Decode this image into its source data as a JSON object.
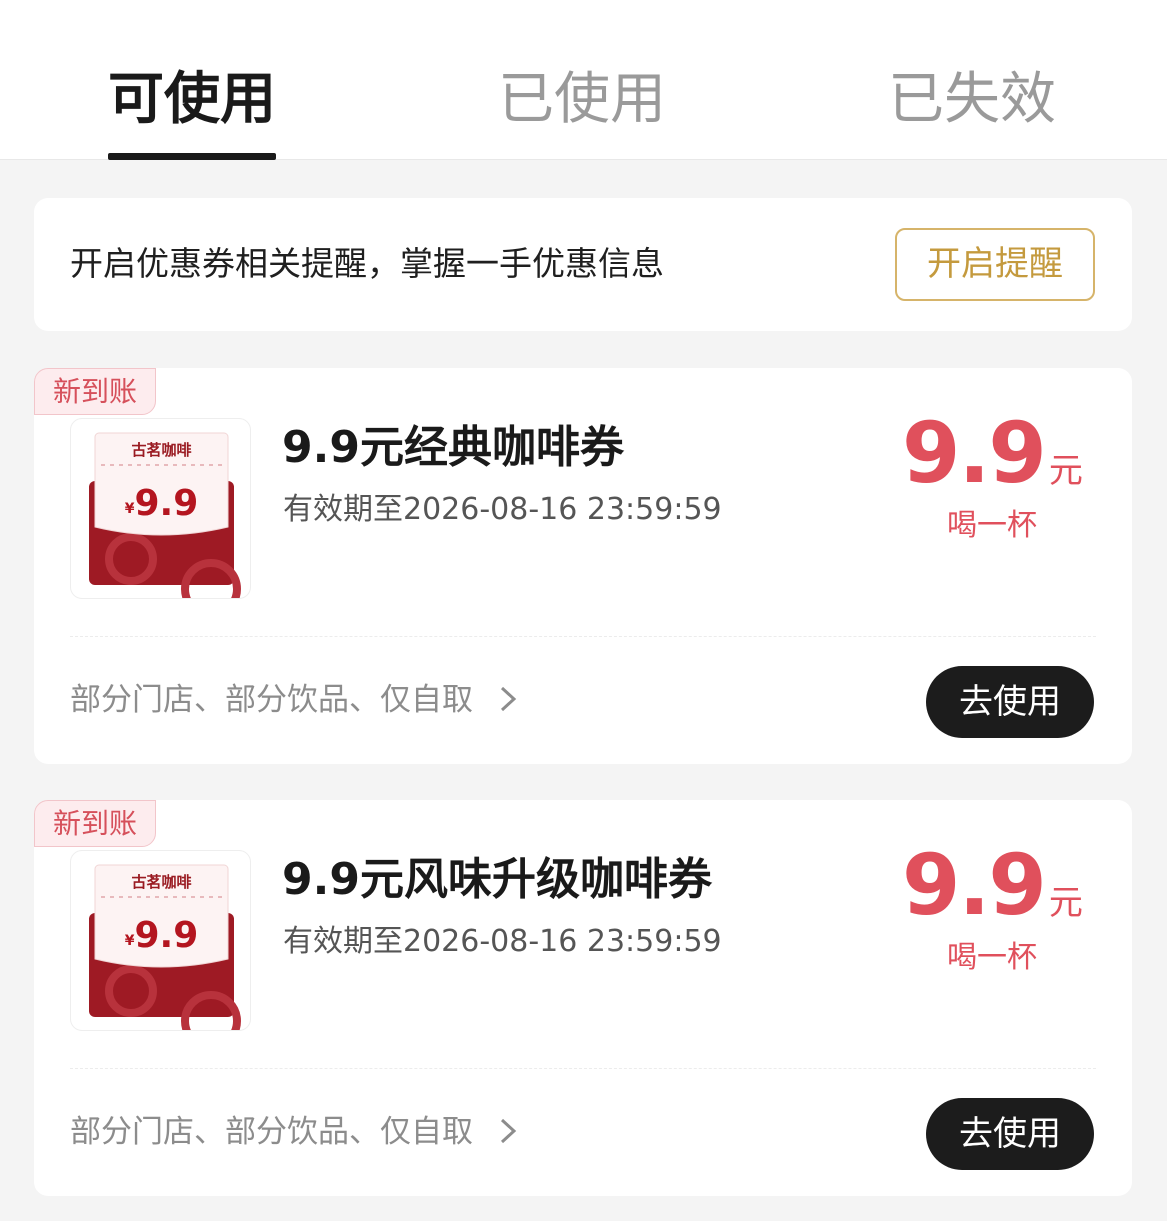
{
  "tabs": [
    {
      "label": "可使用",
      "active": true
    },
    {
      "label": "已使用",
      "active": false
    },
    {
      "label": "已失效",
      "active": false
    }
  ],
  "reminder": {
    "text": "开启优惠券相关提醒，掌握一手优惠信息",
    "button_label": "开启提醒"
  },
  "coupons": [
    {
      "badge": "新到账",
      "thumb_brand": "古茗咖啡",
      "thumb_currency": "¥",
      "thumb_price": "9.9",
      "title": "9.9元经典咖啡券",
      "expiry": "有效期至2026-08-16 23:59:59",
      "value": "9.9",
      "unit": "元",
      "value_note": "喝一杯",
      "terms": "部分门店、部分饮品、仅自取",
      "use_label": "去使用"
    },
    {
      "badge": "新到账",
      "thumb_brand": "古茗咖啡",
      "thumb_currency": "¥",
      "thumb_price": "9.9",
      "title": "9.9元风味升级咖啡券",
      "expiry": "有效期至2026-08-16 23:59:59",
      "value": "9.9",
      "unit": "元",
      "value_note": "喝一杯",
      "terms": "部分门店、部分饮品、仅自取",
      "use_label": "去使用"
    }
  ],
  "colors": {
    "accent_red": "#e0505c",
    "gold": "#c49a3e",
    "dark": "#1c1c1c"
  }
}
